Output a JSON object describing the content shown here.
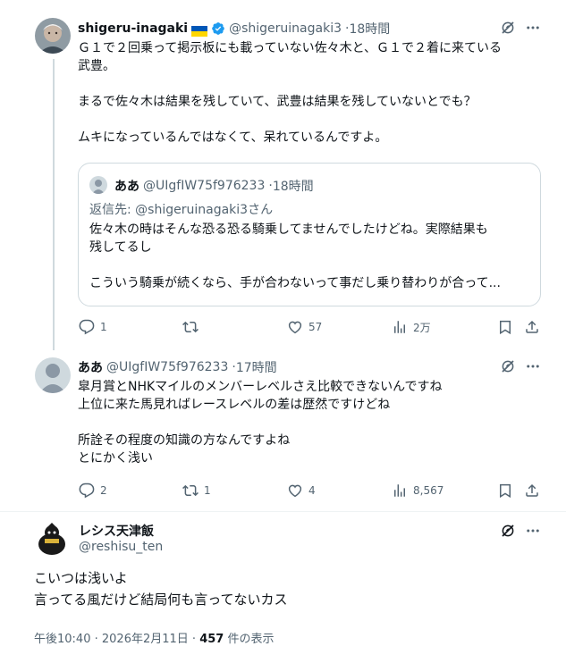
{
  "tweet1": {
    "name": "shigeru-inagaki",
    "flag": "🇺🇦",
    "handle": "@shigeruinagaki3",
    "time": "18時間",
    "lines": [
      "Ｇ１で２回乗って掲示板にも載っていない佐々木と、Ｇ１で２着に来ている",
      "武豊。",
      "",
      "まるで佐々木は結果を残していて、武豊は結果を残していないとでも？",
      "",
      "ムキになっているんではなくて、呆れているんですよ。"
    ],
    "quote": {
      "name": "ああ",
      "handle": "@UIgfIW75f976233",
      "time": "18時間",
      "reply_to_prefix": "返信先: ",
      "reply_to_handle": "@shigeruinagaki3さん",
      "lines": [
        "佐々木の時はそんな恐る恐る騎乗してませんでしたけどね。実際結果も",
        "残してるし",
        "",
        "こういう騎乗が続くなら、手が合わないって事だし乗り替わりが合って..."
      ]
    },
    "stats": {
      "replies": "1",
      "retweets": "",
      "likes": "57",
      "views": "2万"
    }
  },
  "tweet2": {
    "name": "ああ",
    "handle": "@UIgfIW75f976233",
    "time": "17時間",
    "lines": [
      "皐月賞とNHKマイルのメンバーレベルさえ比較できないんですね",
      "上位に来た馬見ればレースレベルの差は歴然ですけどね",
      "",
      "所詮その程度の知識の方なんですよね",
      "とにかく浅い"
    ],
    "stats": {
      "replies": "2",
      "retweets": "1",
      "likes": "4",
      "views": "8,567"
    }
  },
  "tweet3": {
    "name": "レシス天津飯",
    "handle": "@reshisu_ten",
    "lines": [
      "こいつは浅いよ",
      "言ってる風だけど結局何も言ってないカス"
    ],
    "time": "午後10:40",
    "date": "2026年2月11日",
    "views_count": "457",
    "views_suffix": "件の表示"
  },
  "dot": " · ",
  "icons": [
    "grok-icon",
    "more-icon",
    "reply-icon",
    "retweet-icon",
    "like-icon",
    "views-icon",
    "bookmark-icon",
    "share-icon",
    "verified-icon"
  ],
  "colors": {
    "verified": "#1d9bf0",
    "text": "#0f1419",
    "secondary": "#536471",
    "border": "#cfd9de"
  }
}
